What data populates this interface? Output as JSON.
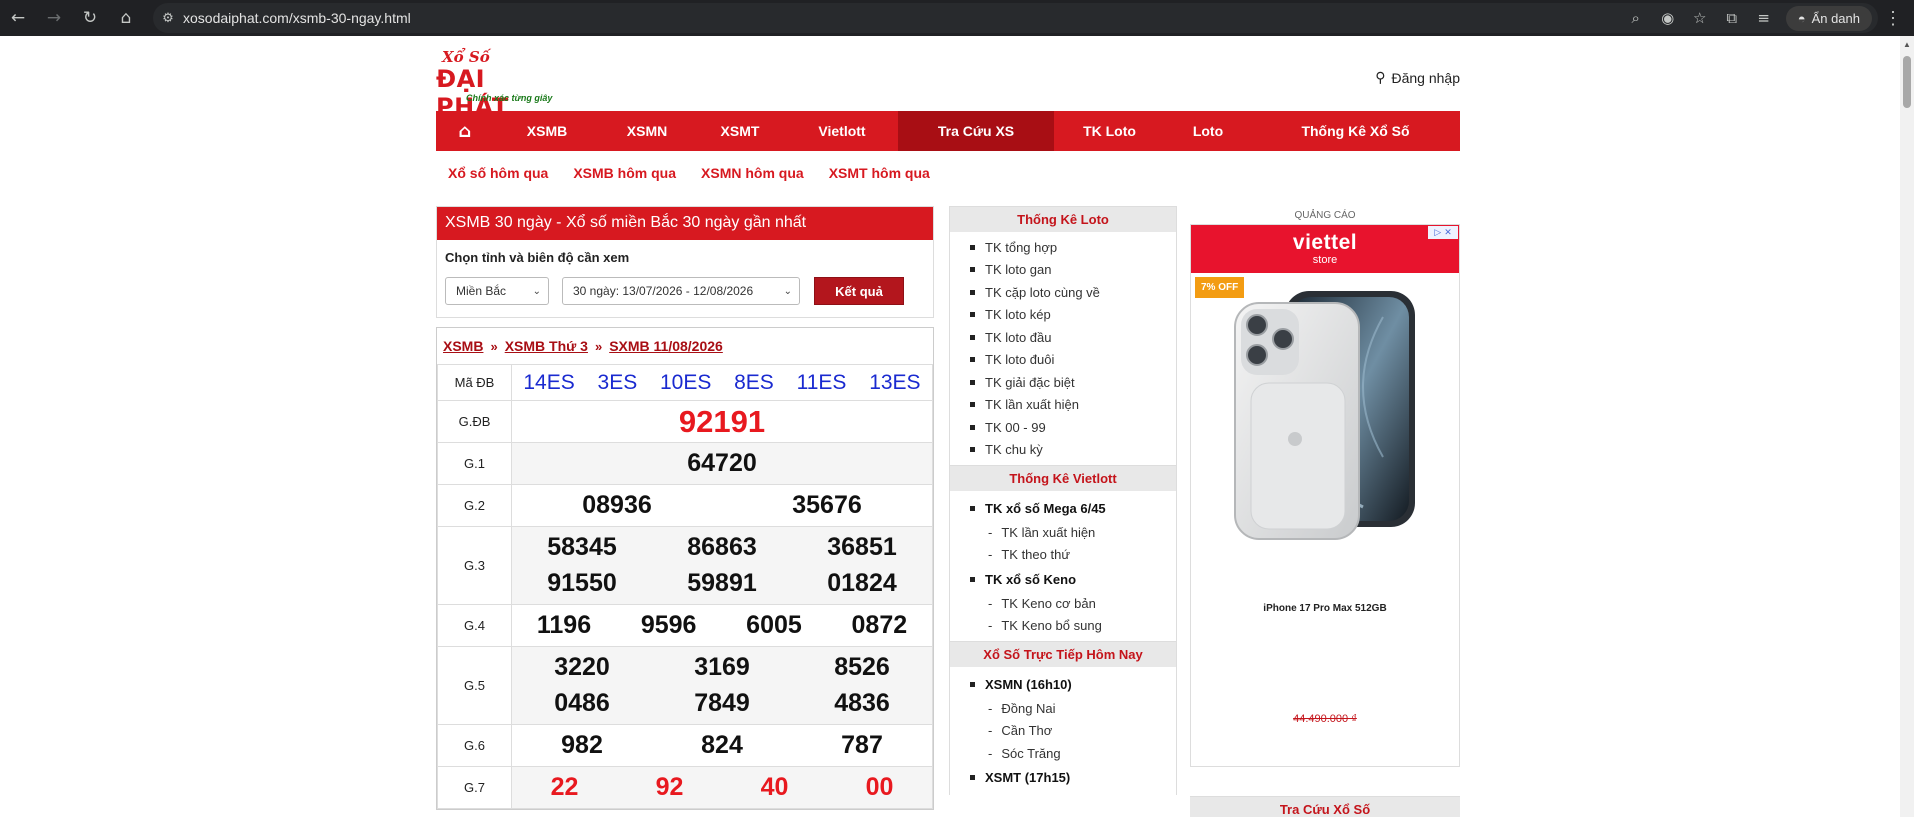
{
  "browser": {
    "url": "xosodaiphat.com/xsmb-30-ngay.html",
    "profile_label": "Ẩn danh"
  },
  "site": {
    "logo_small": "Xổ Số",
    "logo_big": "ĐẠI PHÁT",
    "logo_slogan": "Chính xác từng giây",
    "login_label": "Đăng nhập"
  },
  "main_nav": [
    "XSMB",
    "XSMN",
    "XSMT",
    "Vietlott",
    "Tra Cứu XS",
    "TK Loto",
    "Loto",
    "Thống Kê Xổ Số"
  ],
  "sub_nav": [
    "Xổ số hôm qua",
    "XSMB hôm qua",
    "XSMN hôm qua",
    "XSMT hôm qua"
  ],
  "filter": {
    "title": "XSMB 30 ngày - Xổ số miền Bắc 30 ngày gần nhất",
    "label": "Chọn tỉnh và biên độ cần xem",
    "region": "Miền Bắc",
    "range": "30 ngày: 13/07/2026 - 12/08/2026",
    "submit": "Kết quả"
  },
  "result": {
    "crumb": [
      "XSMB",
      "XSMB Thứ 3",
      "SXMB 11/08/2026"
    ],
    "crumb_sep": "»",
    "code_label": "Mã ĐB",
    "codes": [
      "14ES",
      "3ES",
      "10ES",
      "8ES",
      "11ES",
      "13ES"
    ],
    "prizes": {
      "gdb": {
        "label": "G.ĐB",
        "values": [
          "92191"
        ]
      },
      "g1": {
        "label": "G.1",
        "values": [
          "64720"
        ]
      },
      "g2": {
        "label": "G.2",
        "values": [
          "08936",
          "35676"
        ]
      },
      "g3": {
        "label": "G.3",
        "values": [
          "58345",
          "86863",
          "36851",
          "91550",
          "59891",
          "01824"
        ]
      },
      "g4": {
        "label": "G.4",
        "values": [
          "1196",
          "9596",
          "6005",
          "0872"
        ]
      },
      "g5": {
        "label": "G.5",
        "values": [
          "3220",
          "3169",
          "8526",
          "0486",
          "7849",
          "4836"
        ]
      },
      "g6": {
        "label": "G.6",
        "values": [
          "982",
          "824",
          "787"
        ]
      },
      "g7": {
        "label": "G.7",
        "values": [
          "22",
          "92",
          "40",
          "00"
        ]
      }
    }
  },
  "sidebar": {
    "loto_title": "Thống Kê Loto",
    "loto_items": [
      "TK tổng hợp",
      "TK loto gan",
      "TK cặp loto cùng về",
      "TK loto kép",
      "TK loto đầu",
      "TK loto đuôi",
      "TK giải đặc biệt",
      "TK lần xuất hiện",
      "TK 00 - 99",
      "TK chu kỳ"
    ],
    "vietlott_title": "Thống Kê Vietlott",
    "mega_label": "TK xổ số Mega 6/45",
    "mega_items": [
      "TK lần xuất hiện",
      "TK theo thứ"
    ],
    "keno_label": "TK xổ số Keno",
    "keno_items": [
      "TK Keno cơ bản",
      "TK Keno bổ sung"
    ],
    "live_title": "Xổ Số Trực Tiếp Hôm Nay",
    "xsmn_label": "XSMN (16h10)",
    "xsmn_items": [
      "Đồng Nai",
      "Cần Thơ",
      "Sóc Trăng"
    ],
    "xsmt_label": "XSMT (17h15)"
  },
  "ad": {
    "label": "QUẢNG CÁO",
    "brand": "viettel",
    "store": "store",
    "discount": "7% OFF",
    "product": "iPhone 17 Pro Max 512GB",
    "price": "44.490.000 ₫"
  },
  "right_sidebar": {
    "tracuu_title": "Tra Cứu Xổ Số"
  },
  "colors": {
    "brand_red": "#d71920",
    "active_nav": "#a80e14",
    "code_blue": "#1a2ad0"
  }
}
